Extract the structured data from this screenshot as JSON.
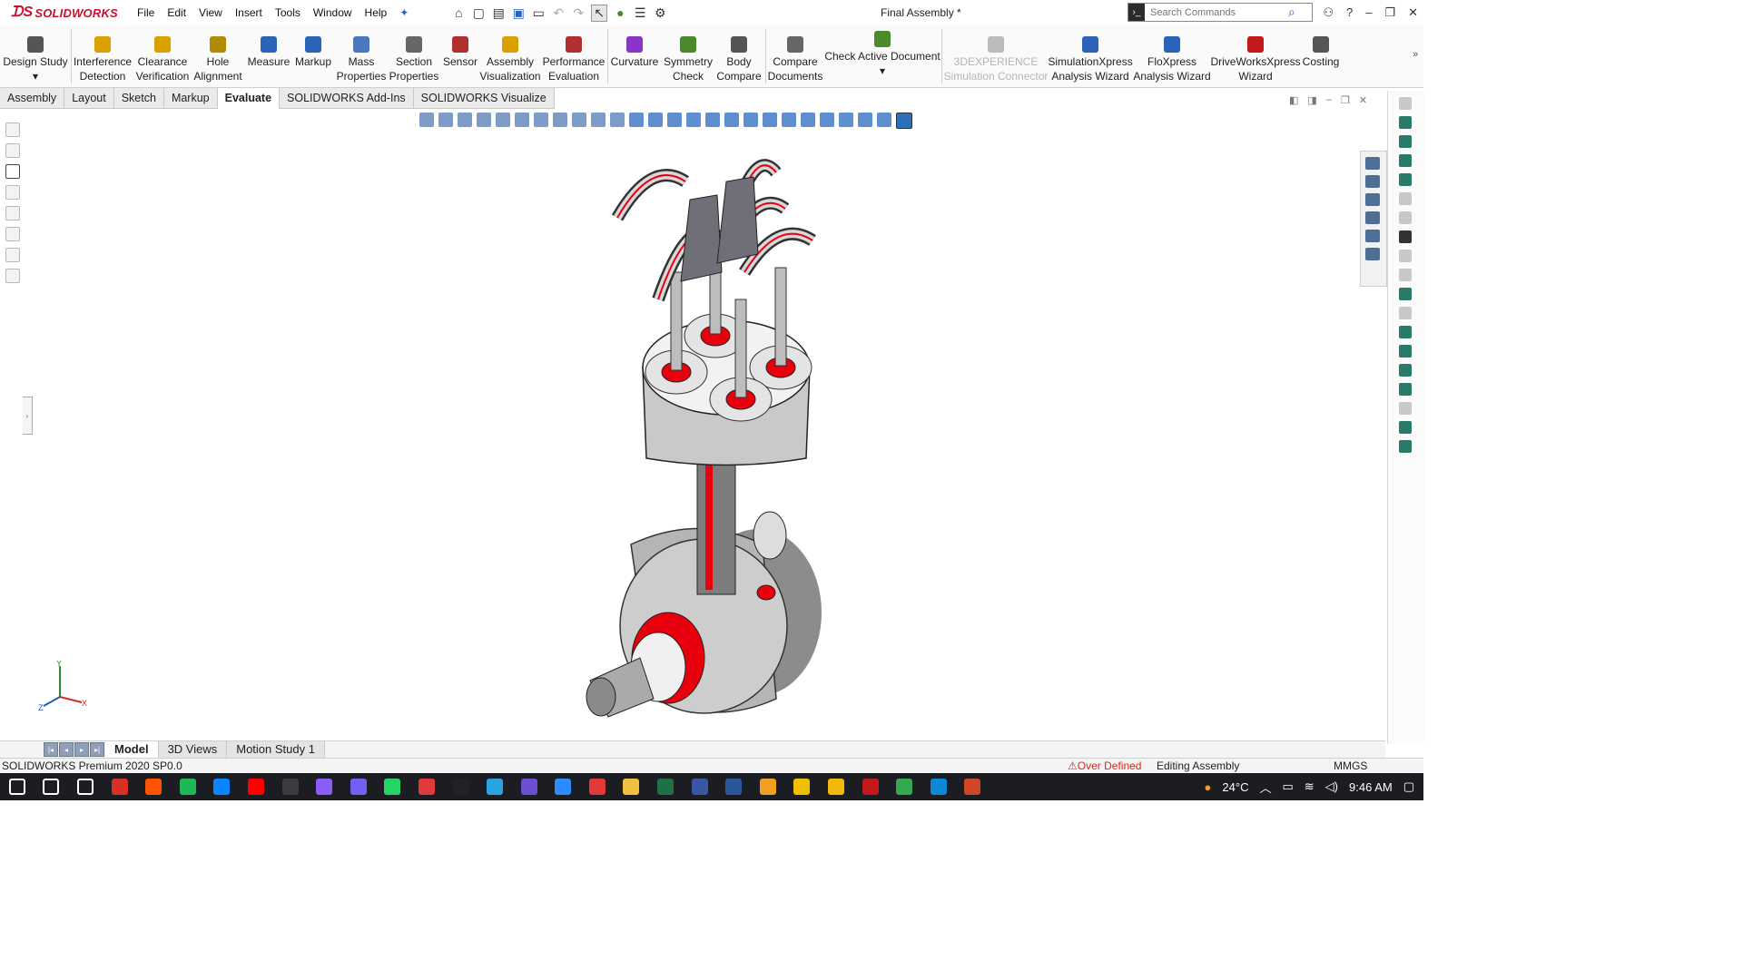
{
  "app": {
    "logo_text": "SOLIDWORKS",
    "document_title": "Final Assembly *"
  },
  "menu": [
    "File",
    "Edit",
    "View",
    "Insert",
    "Tools",
    "Window",
    "Help"
  ],
  "search": {
    "placeholder": "Search Commands"
  },
  "ribbon": [
    {
      "label": "Design Study\n▾",
      "color": "#555"
    },
    {
      "label": "Interference\nDetection",
      "color": "#d9a000"
    },
    {
      "label": "Clearance\nVerification",
      "color": "#d9a000"
    },
    {
      "label": "Hole\nAlignment",
      "color": "#b08a00"
    },
    {
      "label": "Measure",
      "color": "#2a63b8"
    },
    {
      "label": "Markup",
      "color": "#2a63b8"
    },
    {
      "label": "Mass\nProperties",
      "color": "#4a77c2"
    },
    {
      "label": "Section\nProperties",
      "color": "#666"
    },
    {
      "label": "Sensor",
      "color": "#b03030"
    },
    {
      "label": "Assembly\nVisualization",
      "color": "#d9a000"
    },
    {
      "label": "Performance\nEvaluation",
      "color": "#b03030"
    },
    {
      "label": "Curvature",
      "color": "#8a35c9"
    },
    {
      "label": "Symmetry\nCheck",
      "color": "#4a8a2a"
    },
    {
      "label": "Body\nCompare",
      "color": "#555"
    },
    {
      "label": "Compare\nDocuments",
      "color": "#666"
    },
    {
      "label": "Check Active Document\n▾",
      "color": "#4a8a2a"
    },
    {
      "label": "3DEXPERIENCE\nSimulation Connector",
      "color": "#bbb",
      "disabled": true
    },
    {
      "label": "SimulationXpress\nAnalysis Wizard",
      "color": "#2a63b8"
    },
    {
      "label": "FloXpress\nAnalysis Wizard",
      "color": "#2a63b8"
    },
    {
      "label": "DriveWorksXpress\nWizard",
      "color": "#c21a1a"
    },
    {
      "label": "Costing",
      "color": "#555"
    }
  ],
  "tabs": [
    {
      "label": "Assembly",
      "active": false
    },
    {
      "label": "Layout",
      "active": false
    },
    {
      "label": "Sketch",
      "active": false
    },
    {
      "label": "Markup",
      "active": false
    },
    {
      "label": "Evaluate",
      "active": true
    },
    {
      "label": "SOLIDWORKS Add-Ins",
      "active": false
    },
    {
      "label": "SOLIDWORKS Visualize",
      "active": false
    }
  ],
  "bottom_tabs": [
    {
      "label": "Model",
      "active": true
    },
    {
      "label": "3D Views",
      "active": false
    },
    {
      "label": "Motion Study 1",
      "active": false
    }
  ],
  "status": {
    "product": "SOLIDWORKS Premium 2020 SP0.0",
    "over_defined": "Over Defined",
    "mode": "Editing Assembly",
    "units": "MMGS"
  },
  "triad": {
    "x": "X",
    "y": "Y",
    "z": "Z"
  },
  "taskbar": {
    "icons": [
      "windows-start-icon",
      "search-icon",
      "task-view-icon",
      "gmail-icon",
      "soundcloud-icon",
      "spotify-icon",
      "store-icon",
      "youtube-icon",
      "steam-icon",
      "messenger-icon",
      "viber-icon",
      "whatsapp-icon",
      "record-icon",
      "inkscape-icon",
      "telegram-icon",
      "media-icon",
      "zoom-icon",
      "davinci-icon",
      "explorer-icon",
      "excel-icon",
      "visio-icon",
      "word-icon",
      "settings-icon",
      "player-icon",
      "binance-icon",
      "solidworks-icon",
      "chrome-icon",
      "edge-icon",
      "powerpoint-icon"
    ],
    "temperature": "24°C",
    "time": "9:46 AM"
  },
  "colors": {
    "accent_red": "#e8000c",
    "part_gray": "#c9c9c9",
    "brand_red": "#c8102e"
  }
}
